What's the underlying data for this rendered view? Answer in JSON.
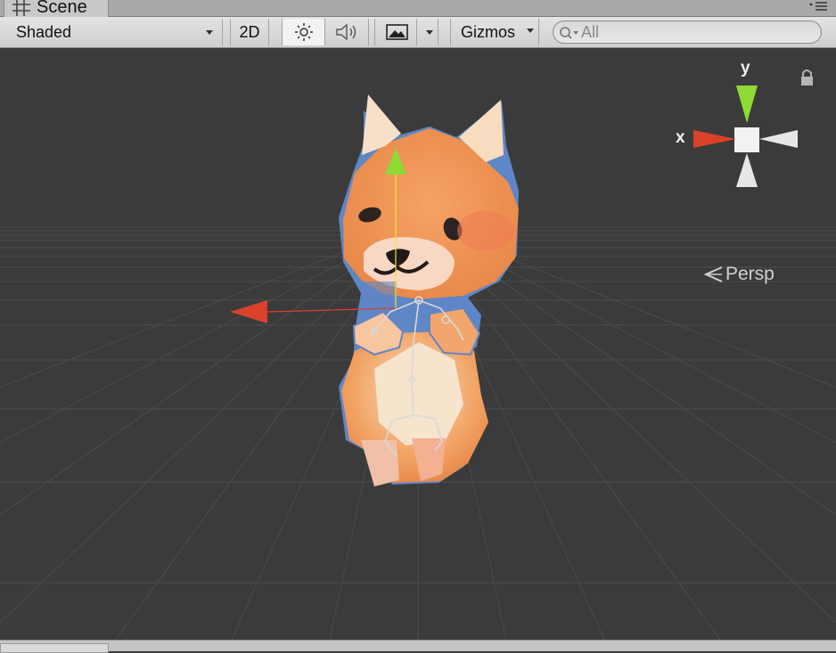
{
  "window": {
    "tab_title": "Scene"
  },
  "toolbar": {
    "draw_mode": "Shaded",
    "mode_2d_label": "2D",
    "gizmos_label": "Gizmos",
    "search_value": "All",
    "lighting_on": true
  },
  "scene_gizmo": {
    "y_label": "y",
    "x_label": "x",
    "projection_label": "Persp"
  },
  "icons": [
    "scene-grid-icon",
    "tab-menu-icon",
    "lighting-icon",
    "audio-icon",
    "effects-icon",
    "search-icon",
    "lock-icon"
  ],
  "colors": {
    "x_axis": "#d9412b",
    "y_axis": "#8fd934",
    "selection_outline": "#5f86c6",
    "viewport_bg": "#3b3b3b"
  }
}
